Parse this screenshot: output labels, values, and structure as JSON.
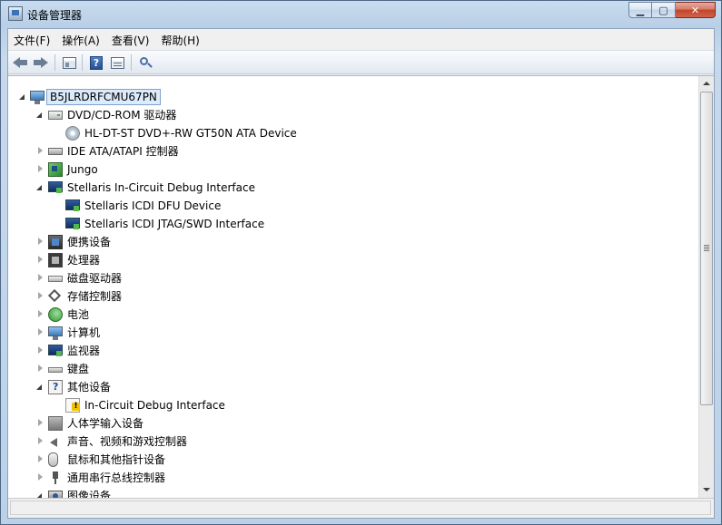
{
  "window": {
    "title": "设备管理器"
  },
  "menu": [
    {
      "label": "文件(F)"
    },
    {
      "label": "操作(A)"
    },
    {
      "label": "查看(V)"
    },
    {
      "label": "帮助(H)"
    }
  ],
  "toolbar": {
    "buttons": [
      {
        "icon": "back-arrow-icon"
      },
      {
        "icon": "forward-arrow-icon"
      },
      {
        "icon": "show-hide-console-tree-icon"
      },
      {
        "icon": "help-icon"
      },
      {
        "icon": "properties-icon"
      },
      {
        "icon": "scan-hardware-icon"
      }
    ]
  },
  "tree": {
    "root": {
      "label": "B5JLRDRFCMU67PN",
      "state": "expanded"
    },
    "items": [
      {
        "label": "DVD/CD-ROM 驱动器",
        "level": 1,
        "state": "expanded",
        "icon": "dvd-drive-icon"
      },
      {
        "label": "HL-DT-ST DVD+-RW GT50N ATA Device",
        "level": 2,
        "state": "leaf",
        "icon": "disc-icon"
      },
      {
        "label": "IDE ATA/ATAPI 控制器",
        "level": 1,
        "state": "collapsed",
        "icon": "ide-controller-icon"
      },
      {
        "label": "Jungo",
        "level": 1,
        "state": "collapsed",
        "icon": "network-device-icon"
      },
      {
        "label": "Stellaris In-Circuit Debug Interface",
        "level": 1,
        "state": "expanded",
        "icon": "debug-interface-icon"
      },
      {
        "label": "Stellaris ICDI DFU Device",
        "level": 2,
        "state": "leaf",
        "icon": "debug-device-icon"
      },
      {
        "label": "Stellaris ICDI JTAG/SWD Interface",
        "level": 2,
        "state": "leaf",
        "icon": "debug-device-icon"
      },
      {
        "label": "便携设备",
        "level": 1,
        "state": "collapsed",
        "icon": "portable-device-icon"
      },
      {
        "label": "处理器",
        "level": 1,
        "state": "collapsed",
        "icon": "processor-icon"
      },
      {
        "label": "磁盘驱动器",
        "level": 1,
        "state": "collapsed",
        "icon": "disk-drive-icon"
      },
      {
        "label": "存储控制器",
        "level": 1,
        "state": "collapsed",
        "icon": "storage-controller-icon"
      },
      {
        "label": "电池",
        "level": 1,
        "state": "collapsed",
        "icon": "battery-icon"
      },
      {
        "label": "计算机",
        "level": 1,
        "state": "collapsed",
        "icon": "computer-icon"
      },
      {
        "label": "监视器",
        "level": 1,
        "state": "collapsed",
        "icon": "monitor-icon"
      },
      {
        "label": "键盘",
        "level": 1,
        "state": "collapsed",
        "icon": "keyboard-icon"
      },
      {
        "label": "其他设备",
        "level": 1,
        "state": "expanded",
        "icon": "other-devices-icon"
      },
      {
        "label": "In-Circuit Debug Interface",
        "level": 2,
        "state": "leaf",
        "icon": "warning-device-icon"
      },
      {
        "label": "人体学输入设备",
        "level": 1,
        "state": "collapsed",
        "icon": "hid-icon"
      },
      {
        "label": "声音、视频和游戏控制器",
        "level": 1,
        "state": "collapsed",
        "icon": "sound-icon"
      },
      {
        "label": "鼠标和其他指针设备",
        "level": 1,
        "state": "collapsed",
        "icon": "mouse-icon"
      },
      {
        "label": "通用串行总线控制器",
        "level": 1,
        "state": "collapsed",
        "icon": "usb-icon"
      },
      {
        "label": "图像设备",
        "level": 1,
        "state": "expanded",
        "icon": "camera-icon"
      }
    ]
  },
  "colors": {
    "selection_fill": "#dcebfc",
    "selection_border": "#7da2ce",
    "title_gradient": "#c9dcef"
  }
}
